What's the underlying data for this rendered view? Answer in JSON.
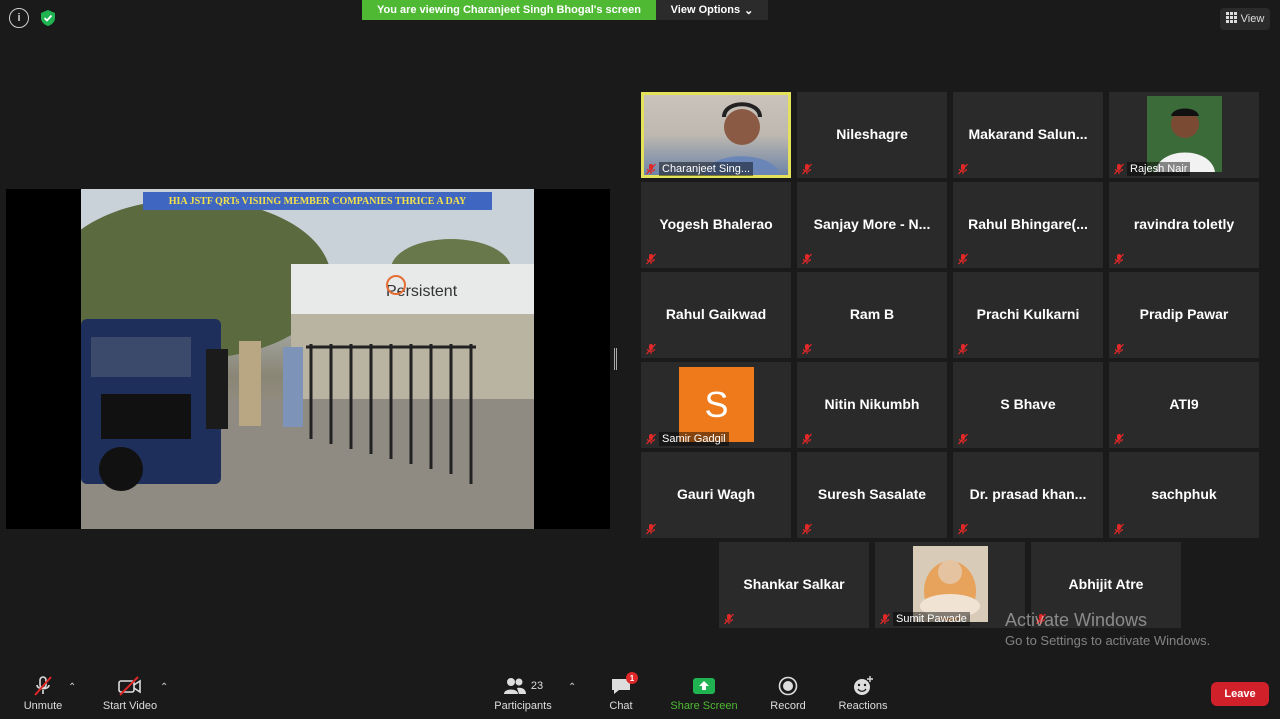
{
  "top": {
    "banner": "You are viewing Charanjeet Singh Bhogal's screen",
    "view_options": "View Options",
    "view": "View"
  },
  "share": {
    "caption": "HIA JSTF QRTs  VISIING MEMBER COMPANIES THRICE A DAY",
    "sign_text": "Persistent"
  },
  "participants": [
    {
      "label": "Charanjeet Sing..."
    },
    {
      "name": "Nileshagre"
    },
    {
      "name": "Makarand  Salun..."
    },
    {
      "label": "Rajesh Nair"
    },
    {
      "name": "Yogesh Bhalerao"
    },
    {
      "name": "Sanjay More - N..."
    },
    {
      "name": "Rahul  Bhingare(..."
    },
    {
      "name": "ravindra toletly"
    },
    {
      "name": "Rahul Gaikwad"
    },
    {
      "name": "Ram B"
    },
    {
      "name": "Prachi Kulkarni"
    },
    {
      "name": "Pradip Pawar"
    },
    {
      "label": "Samir Gadgil",
      "avatar": "S"
    },
    {
      "name": "Nitin Nikumbh"
    },
    {
      "name": "S Bhave"
    },
    {
      "name": "ATI9"
    },
    {
      "name": "Gauri Wagh"
    },
    {
      "name": "Suresh Sasalate"
    },
    {
      "name": "Dr. prasad khan..."
    },
    {
      "name": "sachphuk"
    },
    {
      "name": "Shankar Salkar"
    },
    {
      "label": "Sumit Pawade"
    },
    {
      "name": "Abhijit Atre"
    }
  ],
  "watermark": {
    "title": "Activate Windows",
    "subtitle": "Go to Settings to activate Windows."
  },
  "toolbar": {
    "unmute": "Unmute",
    "start_video": "Start Video",
    "participants": "Participants",
    "participant_count": "23",
    "chat": "Chat",
    "chat_badge": "1",
    "share_screen": "Share Screen",
    "record": "Record",
    "reactions": "Reactions",
    "leave": "Leave"
  },
  "colors": {
    "banner_green": "#4fb934",
    "active_speaker": "#e3e25a",
    "leave_red": "#d0202a",
    "muted_red": "#e02828"
  }
}
